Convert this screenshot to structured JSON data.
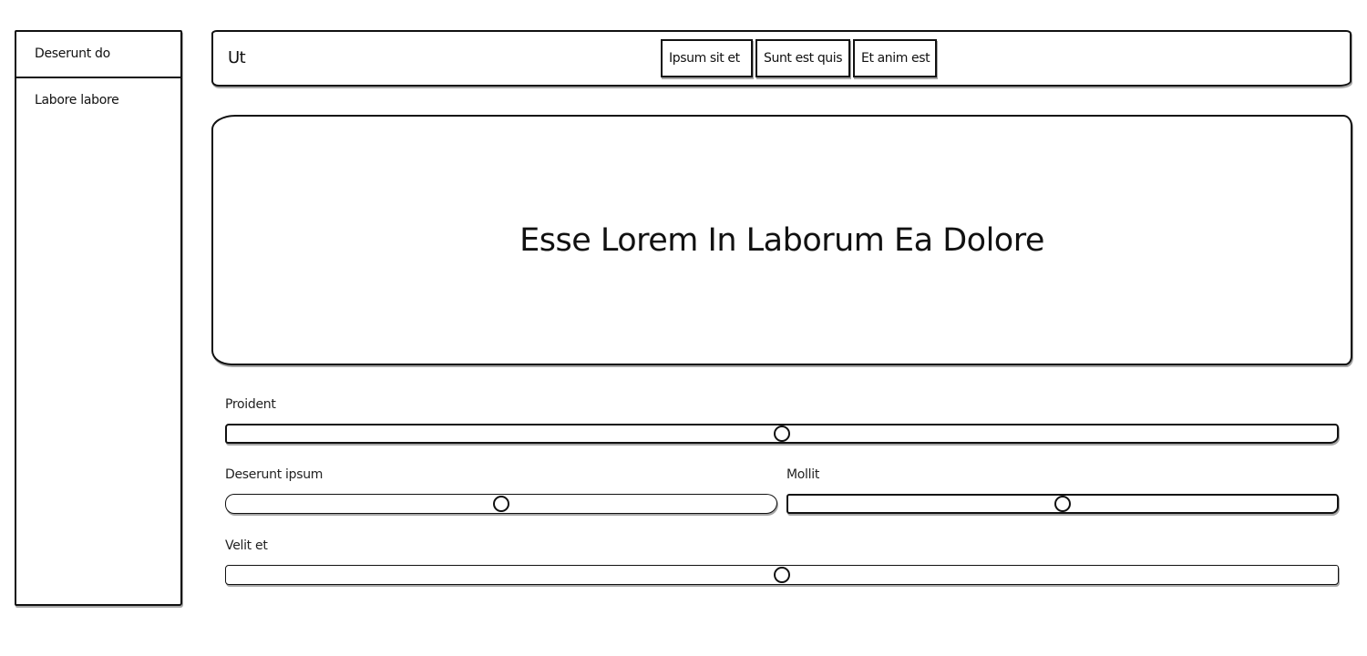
{
  "sidebar": {
    "items": [
      {
        "label": "Deserunt do"
      },
      {
        "label": "Labore labore"
      }
    ]
  },
  "header": {
    "title": "Ut",
    "tabs": [
      {
        "label": "Ipsum sit et"
      },
      {
        "label": "Sunt est quis"
      },
      {
        "label": "Et anim est"
      }
    ]
  },
  "hero": {
    "title": "Esse Lorem In Laborum Ea Dolore"
  },
  "sliders": [
    {
      "label": "Proident",
      "value": 0.5
    },
    {
      "label": "Deserunt ipsum",
      "value": 0.5
    },
    {
      "label": "Mollit",
      "value": 0.5
    },
    {
      "label": "Velit et",
      "value": 0.5
    }
  ],
  "colors": {
    "ink": "#111111",
    "background": "#ffffff"
  }
}
